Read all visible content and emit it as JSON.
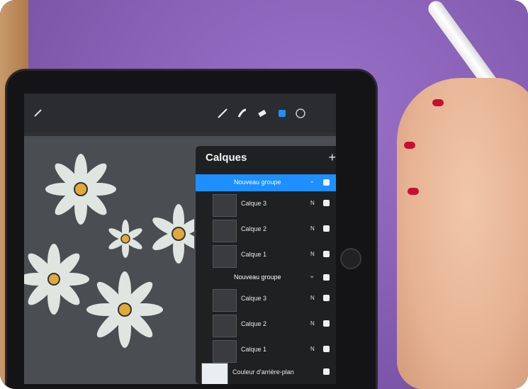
{
  "layers_panel": {
    "title": "Calques",
    "add_label": "+",
    "rows": [
      {
        "label": "Nouveau groupe",
        "type": "group",
        "selected": true
      },
      {
        "label": "Calque 3",
        "type": "layer",
        "mode": "N"
      },
      {
        "label": "Calque 2",
        "type": "layer",
        "mode": "N"
      },
      {
        "label": "Calque 1",
        "type": "layer",
        "mode": "N"
      },
      {
        "label": "Nouveau groupe",
        "type": "group",
        "selected": false
      },
      {
        "label": "Calque 3",
        "type": "layer",
        "mode": "N"
      },
      {
        "label": "Calque 2",
        "type": "layer",
        "mode": "N"
      },
      {
        "label": "Calque 1",
        "type": "layer",
        "mode": "N"
      },
      {
        "label": "Couleur d'arrière-plan",
        "type": "background"
      }
    ]
  },
  "colors": {
    "backdrop": "#8a62b8",
    "selected_group": "#1e8fff",
    "panel": "#1f2022"
  }
}
